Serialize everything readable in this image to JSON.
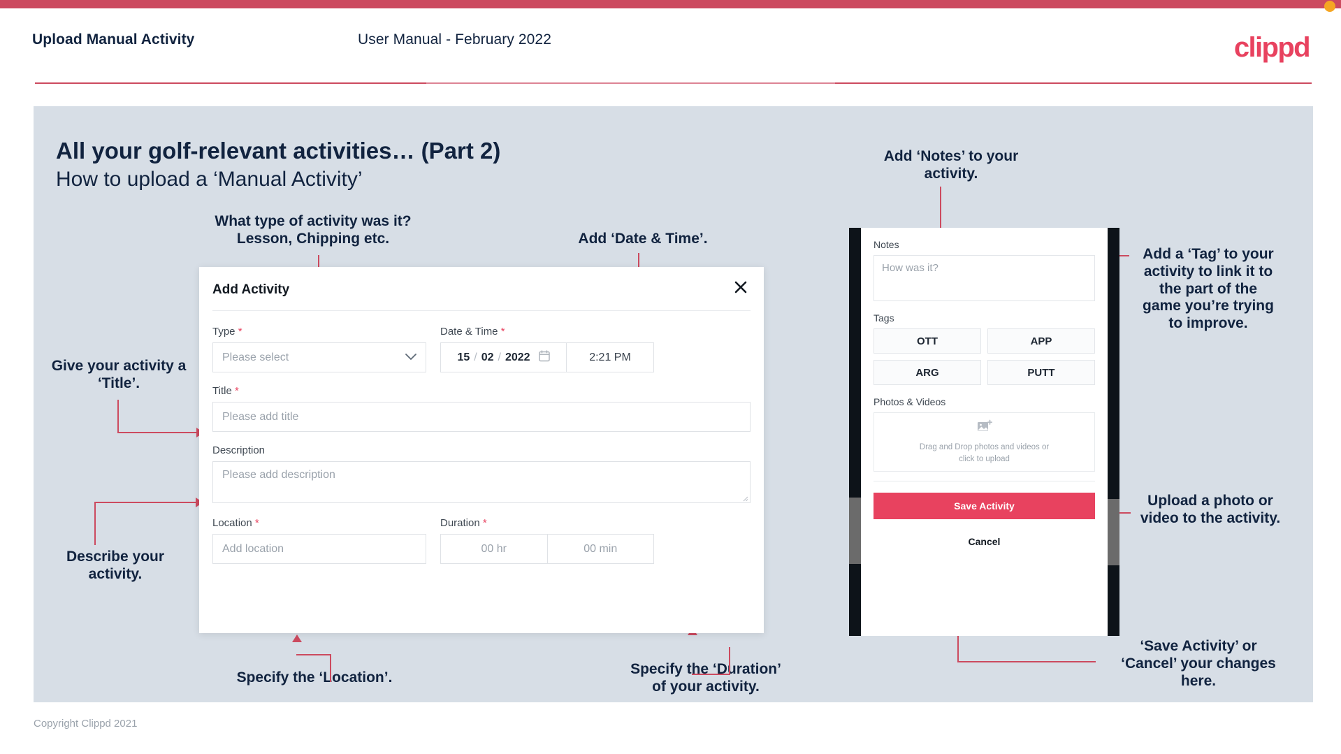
{
  "header": {
    "title": "Upload Manual Activity",
    "subtitle": "User Manual - February 2022",
    "logo": "clippd"
  },
  "slide": {
    "title": "All your golf-relevant activities… (Part 2)",
    "subtitle": "How to upload a ‘Manual Activity’"
  },
  "footer": {
    "copyright": "Copyright Clippd 2021"
  },
  "colors": {
    "brand_pink": "#e8425f",
    "rule_red": "#cc4a5f",
    "slide_bg": "#d7dee6",
    "text_navy": "#11233f",
    "accent_dot": "#f5a623"
  },
  "modal": {
    "title": "Add Activity",
    "close_icon": "close-icon",
    "fields": {
      "type": {
        "label": "Type",
        "required": "*",
        "value": "Please select",
        "chevron": "chevron-down-icon"
      },
      "datetime": {
        "label": "Date & Time",
        "required": "*",
        "day": "15",
        "month": "02",
        "year": "2022",
        "separator": "/",
        "calendar_icon": "calendar-icon",
        "time": "2:21 PM"
      },
      "title": {
        "label": "Title",
        "required": "*",
        "placeholder": "Please add title"
      },
      "description": {
        "label": "Description",
        "placeholder": "Please add description"
      },
      "location": {
        "label": "Location",
        "required": "*",
        "placeholder": "Add location"
      },
      "duration": {
        "label": "Duration",
        "required": "*",
        "hours": "00 hr",
        "minutes": "00 min"
      }
    }
  },
  "phone": {
    "notes": {
      "label": "Notes",
      "placeholder": "How was it?"
    },
    "tags": {
      "label": "Tags",
      "items": [
        "OTT",
        "APP",
        "ARG",
        "PUTT"
      ]
    },
    "photos": {
      "label": "Photos & Videos",
      "icon": "add-image-icon",
      "drop_line1": "Drag and Drop photos and videos or",
      "drop_line2": "click to upload"
    },
    "save_label": "Save Activity",
    "cancel_label": "Cancel"
  },
  "annotations": {
    "type": "What type of activity was it?\nLesson, Chipping etc.",
    "datetime": "Add ‘Date & Time’.",
    "title": "Give your activity a\n‘Title’.",
    "description": "Describe your\nactivity.",
    "location": "Specify the ‘Location’.",
    "duration": "Specify the ‘Duration’\nof your activity.",
    "notes": "Add ‘Notes’ to your\nactivity.",
    "tags": "Add a ‘Tag’ to your\nactivity to link it to\nthe part of the\ngame you’re trying\nto improve.",
    "upload": "Upload a photo or\nvideo to the activity.",
    "save": "‘Save Activity’ or\n‘Cancel’ your changes\nhere."
  }
}
